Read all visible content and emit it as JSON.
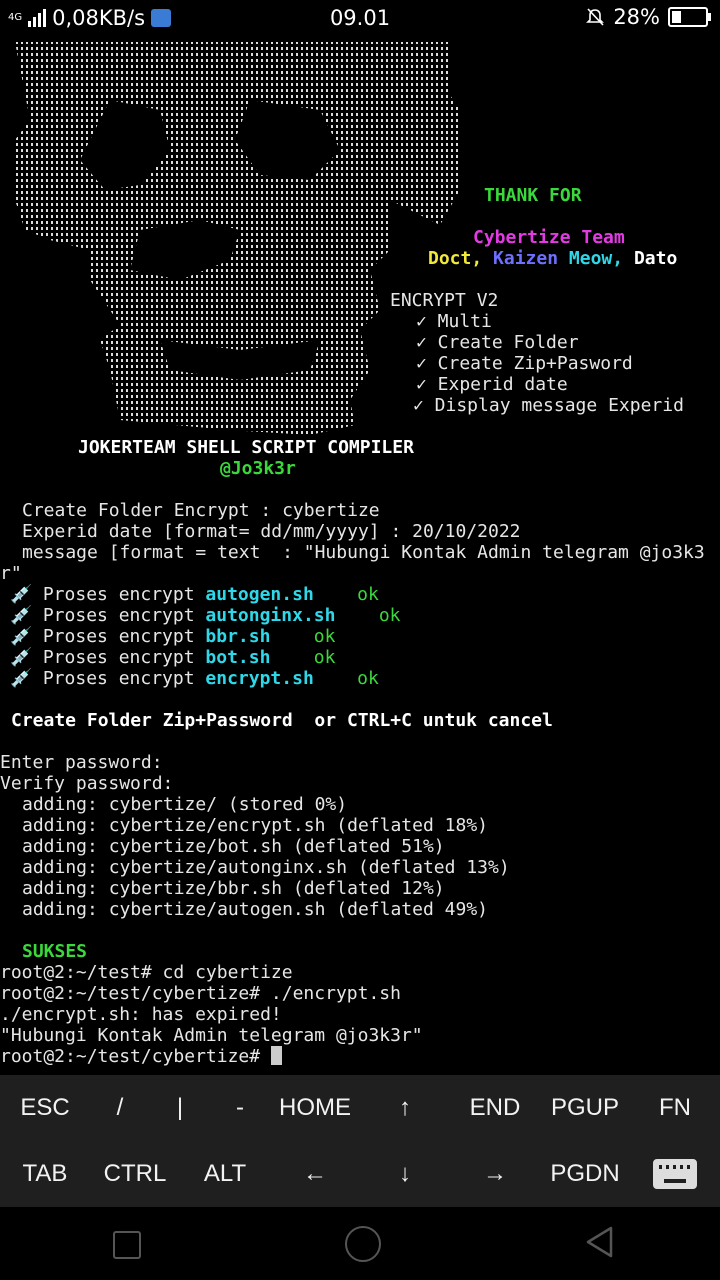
{
  "status": {
    "network_type": "4G",
    "speed": "0,08KB/s",
    "time": "09.01",
    "battery": "28%",
    "battery_level": 0.28
  },
  "banner": {
    "thank": "THANK FOR",
    "team": "Cybertize Team",
    "member1": "Doct,",
    "member2": "Kaizen",
    "member3": "Meow,",
    "member4": "Dato",
    "version": "ENCRYPT V2",
    "features": [
      "✓ Multi",
      "✓ Create Folder",
      "✓ Create Zip+Pasword",
      "✓ Experid date",
      "✓ Display message Experid"
    ],
    "compiler_title": "JOKERTEAM SHELL SCRIPT COMPILER",
    "handle": "@Jo3k3r"
  },
  "prompts": {
    "folder": "Create Folder Encrypt : cybertize",
    "date": "Experid date [format= dd/mm/yyyy] : 20/10/2022",
    "message": "message [format = text  : \"Hubungi Kontak Admin telegram @jo3k3",
    "message_wrap": "r\""
  },
  "encrypt_lines": [
    {
      "prefix": "Proses encrypt",
      "file": "autogen.sh",
      "status": "ok"
    },
    {
      "prefix": "Proses encrypt",
      "file": "autonginx.sh",
      "status": "ok"
    },
    {
      "prefix": "Proses encrypt",
      "file": "bbr.sh",
      "status": "ok"
    },
    {
      "prefix": "Proses encrypt",
      "file": "bot.sh",
      "status": "ok"
    },
    {
      "prefix": "Proses encrypt",
      "file": "encrypt.sh",
      "status": "ok"
    }
  ],
  "zip_prompt": "Create Folder Zip+Password  or CTRL+C untuk cancel",
  "password": {
    "enter": "Enter password:",
    "verify": "Verify password:"
  },
  "adding_lines": [
    "adding: cybertize/ (stored 0%)",
    "adding: cybertize/encrypt.sh (deflated 18%)",
    "adding: cybertize/bot.sh (deflated 51%)",
    "adding: cybertize/autonginx.sh (deflated 13%)",
    "adding: cybertize/bbr.sh (deflated 12%)",
    "adding: cybertize/autogen.sh (deflated 49%)"
  ],
  "sukses": "SUKSES",
  "shell": {
    "line1": "root@2:~/test# cd cybertize",
    "line2": "root@2:~/test/cybertize# ./encrypt.sh",
    "line3": "./encrypt.sh: has expired!",
    "line4": "\"Hubungi Kontak Admin telegram @jo3k3r\"",
    "prompt": "root@2:~/test/cybertize# "
  },
  "keys_row1": [
    "ESC",
    "/",
    "|",
    "-",
    "HOME",
    "↑",
    "END",
    "PGUP",
    "FN"
  ],
  "keys_row2": [
    "TAB",
    "CTRL",
    "ALT",
    "←",
    "↓",
    "→",
    "PGDN"
  ]
}
